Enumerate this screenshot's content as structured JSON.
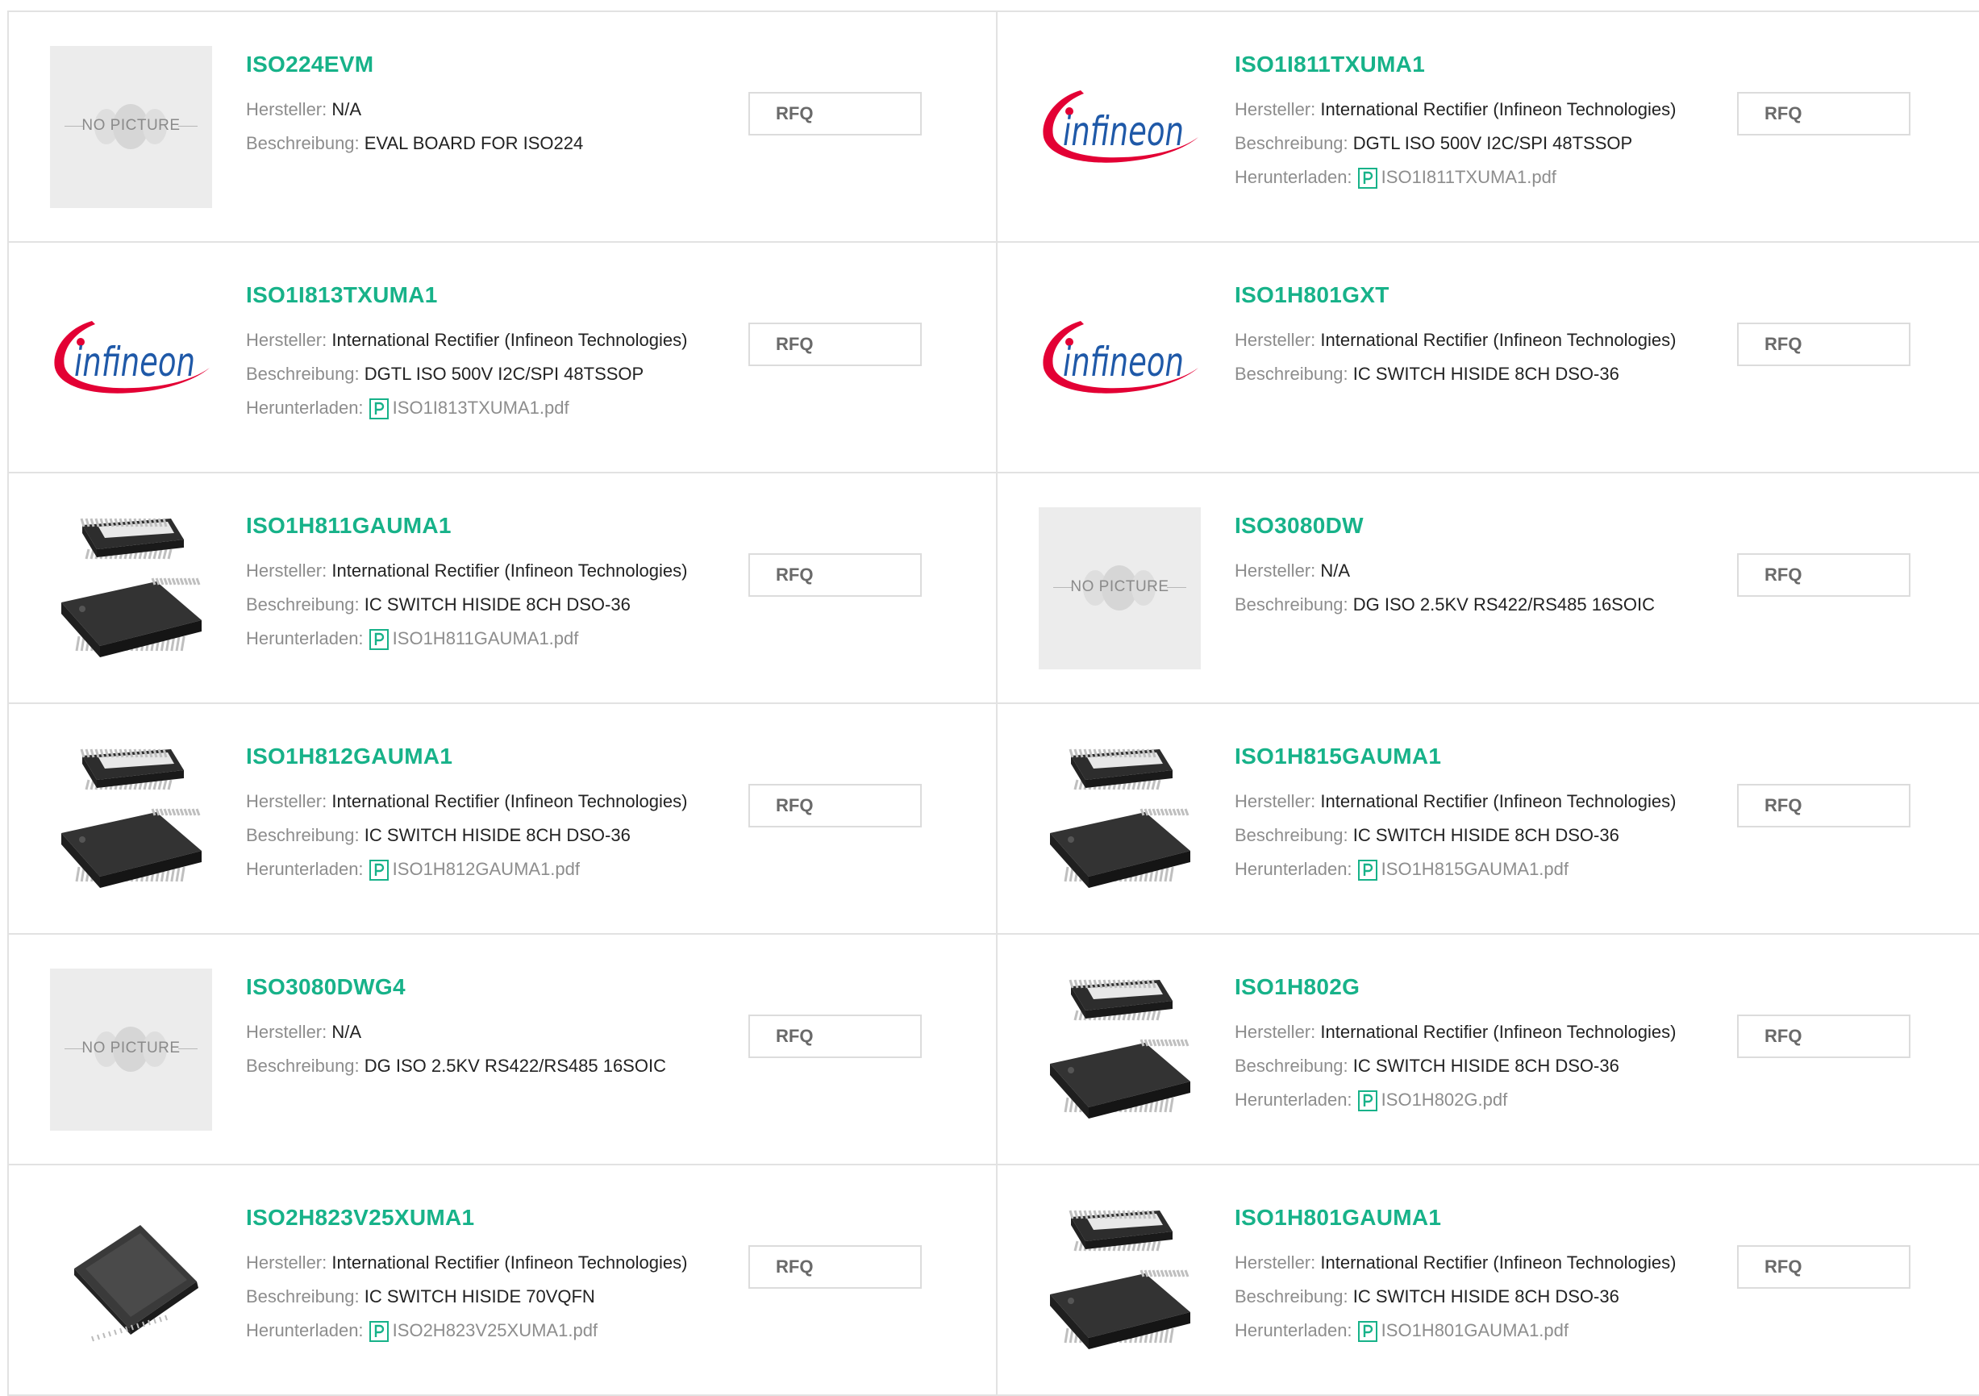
{
  "labels": {
    "manufacturer": "Hersteller:",
    "description": "Beschreibung:",
    "download": "Herunterladen:",
    "rfq": "RFQ",
    "no_picture": "NO PICTURE",
    "infineon_logo": "infineon"
  },
  "products": [
    {
      "title": "ISO224EVM",
      "manufacturer": "N/A",
      "description": "EVAL BOARD FOR ISO224",
      "download": "",
      "image": "no-picture"
    },
    {
      "title": "ISO1I811TXUMA1",
      "manufacturer": "International Rectifier (Infineon Technologies)",
      "description": "DGTL ISO 500V I2C/SPI 48TSSOP",
      "download": "ISO1I811TXUMA1.pdf",
      "image": "infineon-logo"
    },
    {
      "title": "ISO1I813TXUMA1",
      "manufacturer": "International Rectifier (Infineon Technologies)",
      "description": "DGTL ISO 500V I2C/SPI 48TSSOP",
      "download": "ISO1I813TXUMA1.pdf",
      "image": "infineon-logo"
    },
    {
      "title": "ISO1H801GXT",
      "manufacturer": "International Rectifier (Infineon Technologies)",
      "description": "IC SWITCH HISIDE 8CH DSO-36",
      "download": "",
      "image": "infineon-logo"
    },
    {
      "title": "ISO1H811GAUMA1",
      "manufacturer": "International Rectifier (Infineon Technologies)",
      "description": "IC SWITCH HISIDE 8CH DSO-36",
      "download": "ISO1H811GAUMA1.pdf",
      "image": "chip-dso36"
    },
    {
      "title": "ISO3080DW",
      "manufacturer": "N/A",
      "description": "DG ISO 2.5KV RS422/RS485 16SOIC",
      "download": "",
      "image": "no-picture"
    },
    {
      "title": "ISO1H812GAUMA1",
      "manufacturer": "International Rectifier (Infineon Technologies)",
      "description": "IC SWITCH HISIDE 8CH DSO-36",
      "download": "ISO1H812GAUMA1.pdf",
      "image": "chip-dso36"
    },
    {
      "title": "ISO1H815GAUMA1",
      "manufacturer": "International Rectifier (Infineon Technologies)",
      "description": "IC SWITCH HISIDE 8CH DSO-36",
      "download": "ISO1H815GAUMA1.pdf",
      "image": "chip-dso36"
    },
    {
      "title": "ISO3080DWG4",
      "manufacturer": "N/A",
      "description": "DG ISO 2.5KV RS422/RS485 16SOIC",
      "download": "",
      "image": "no-picture"
    },
    {
      "title": "ISO1H802G",
      "manufacturer": "International Rectifier (Infineon Technologies)",
      "description": "IC SWITCH HISIDE 8CH DSO-36",
      "download": "ISO1H802G.pdf",
      "image": "chip-dso36"
    },
    {
      "title": "ISO2H823V25XUMA1",
      "manufacturer": "International Rectifier (Infineon Technologies)",
      "description": "IC SWITCH HISIDE 70VQFN",
      "download": "ISO2H823V25XUMA1.pdf",
      "image": "chip-vqfn"
    },
    {
      "title": "ISO1H801GAUMA1",
      "manufacturer": "International Rectifier (Infineon Technologies)",
      "description": "IC SWITCH HISIDE 8CH DSO-36",
      "download": "ISO1H801GAUMA1.pdf",
      "image": "chip-dso36"
    }
  ],
  "colors": {
    "title_green": "#17b289",
    "label_gray": "#8d8d8d",
    "border": "#e2e2e2",
    "infineon_red": "#e30034",
    "infineon_blue": "#1f59a8"
  }
}
